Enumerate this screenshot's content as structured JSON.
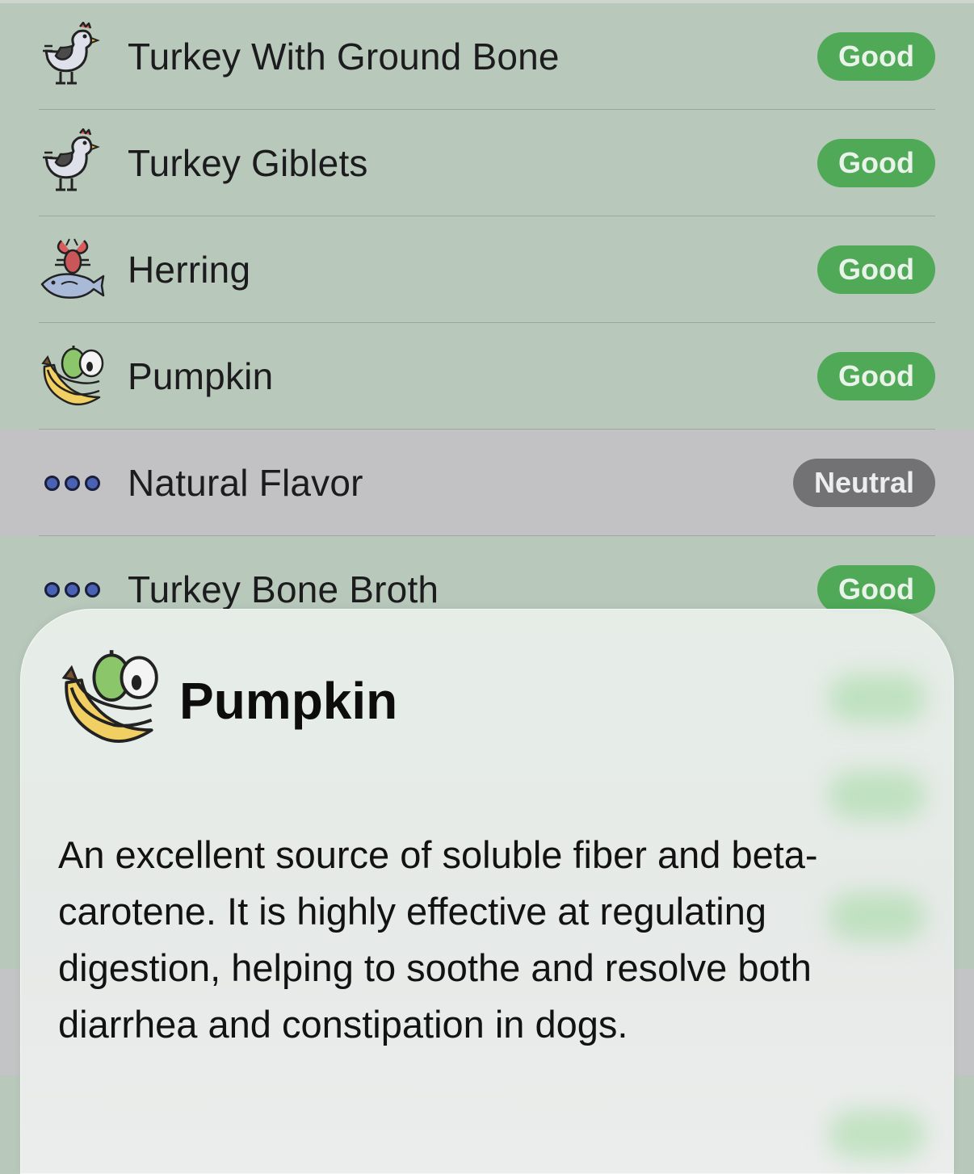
{
  "ingredients": [
    {
      "name": "Turkey With Ground Bone",
      "rating": "Good",
      "icon": "chicken-icon"
    },
    {
      "name": "Turkey Giblets",
      "rating": "Good",
      "icon": "chicken-icon"
    },
    {
      "name": "Herring",
      "rating": "Good",
      "icon": "seafood-icon"
    },
    {
      "name": "Pumpkin",
      "rating": "Good",
      "icon": "fruit-icon"
    },
    {
      "name": "Natural Flavor",
      "rating": "Neutral",
      "icon": "more-dots-icon"
    },
    {
      "name": "Turkey Bone Broth",
      "rating": "Good",
      "icon": "more-dots-icon"
    }
  ],
  "detail": {
    "title": "Pumpkin",
    "icon": "fruit-icon",
    "description": "An excellent source of soluble fiber and beta-carotene. It is highly effective at regulating digestion, helping to soothe and resolve both diarrhea and constipation in dogs."
  },
  "colors": {
    "good": "#4fa957",
    "neutral": "#727275",
    "row_good_bg": "#b8c8bb",
    "row_neutral_bg": "#c2c2c4"
  }
}
